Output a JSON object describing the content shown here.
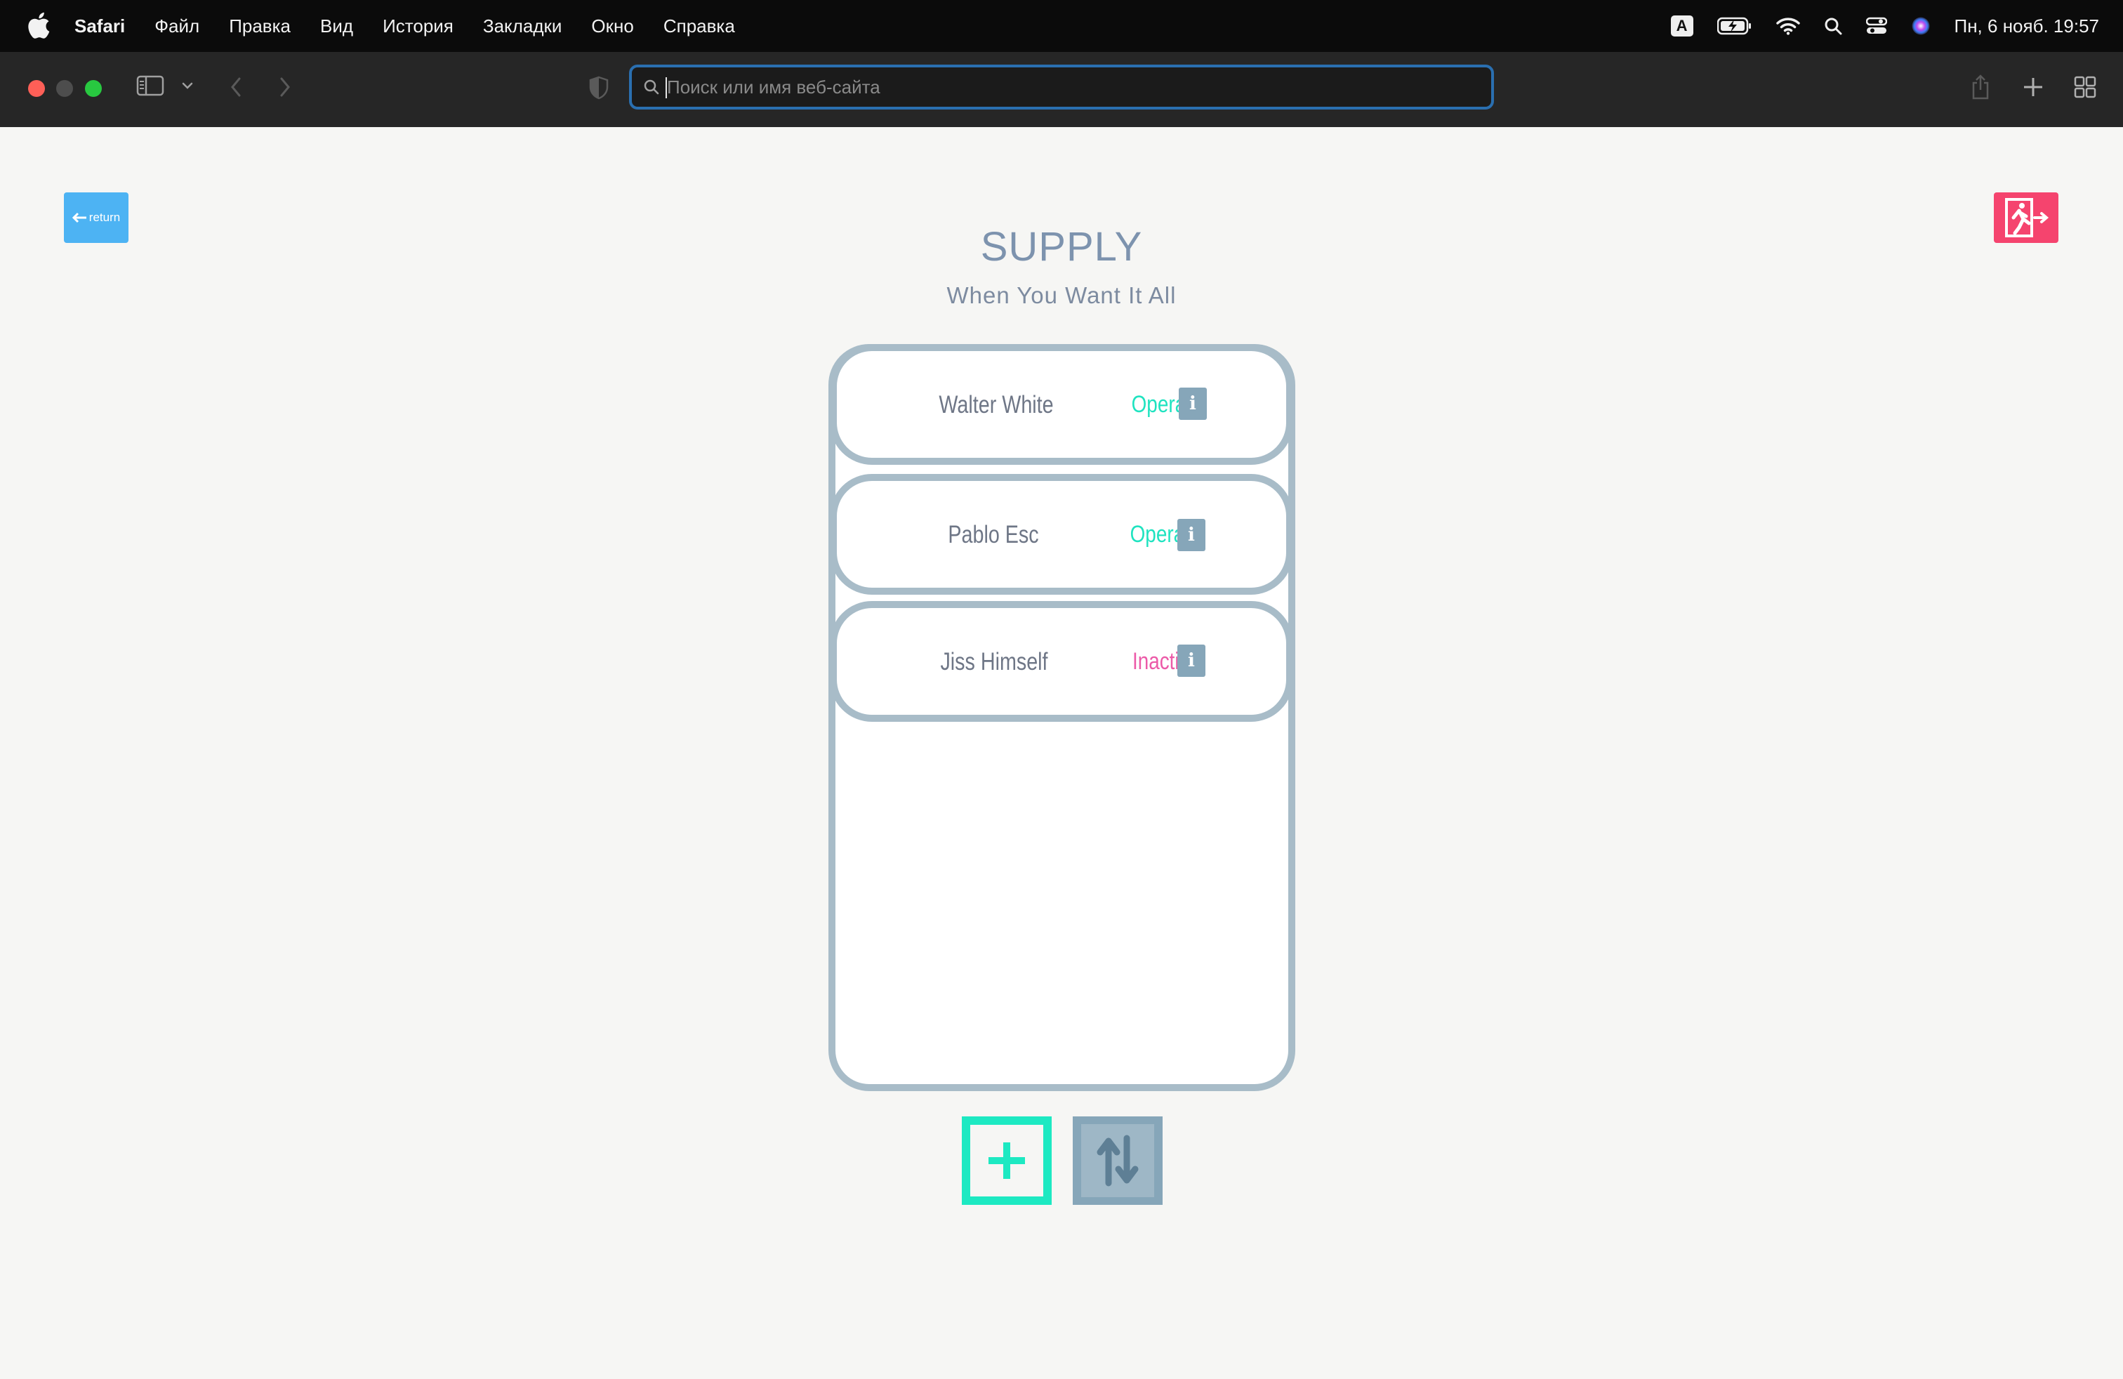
{
  "menubar": {
    "app_name": "Safari",
    "menus": [
      "Файл",
      "Правка",
      "Вид",
      "История",
      "Закладки",
      "Окно",
      "Справка"
    ],
    "input_source": "A",
    "clock": "Пн, 6 нояб.  19:57"
  },
  "browser": {
    "url_placeholder": "Поиск или имя веб-сайта",
    "url_value": ""
  },
  "page": {
    "return_label": "return",
    "title": "SUPPLY",
    "subtitle": "When You Want It All",
    "info_label": "i",
    "rows": [
      {
        "name": "Walter White",
        "status": "Operate"
      },
      {
        "name": "Pablo Esc",
        "status": "Operate"
      },
      {
        "name": "Jiss Himself",
        "status": "Inactive"
      }
    ]
  },
  "colors": {
    "accent_teal": "#1de9c2",
    "inactive_pink": "#ec5aa8",
    "info_gray": "#86a6b9",
    "return_blue": "#4db3f3",
    "exit_red": "#f5446e",
    "panel_border": "#a8bcc8"
  },
  "icons": {
    "return": "arrow-left-icon",
    "exit": "emergency-exit-icon",
    "add": "plus-icon",
    "sort": "sort-arrows-icon"
  }
}
